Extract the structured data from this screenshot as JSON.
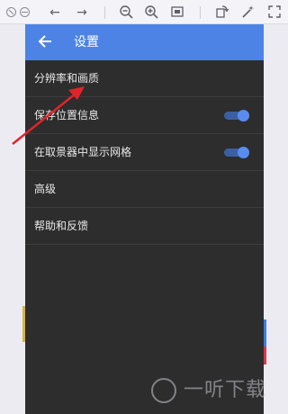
{
  "toolbar": {
    "icons": [
      "close-icon",
      "minimize-icon",
      "back-arrow-icon",
      "forward-arrow-icon",
      "zoom-out-icon",
      "zoom-in-icon",
      "fit-screen-icon",
      "rotate-icon",
      "magic-wand-icon",
      "maximize-icon"
    ]
  },
  "appbar": {
    "title": "设置"
  },
  "settings": {
    "items": [
      {
        "label": "分辨率和画质"
      },
      {
        "label": "保存位置信息",
        "toggle": true
      },
      {
        "label": "在取景器中显示网格",
        "toggle": true
      },
      {
        "label": "高级"
      },
      {
        "label": "帮助和反馈"
      }
    ]
  },
  "colors": {
    "appbar": "#4e83e6",
    "background": "#2d2d2d",
    "toggle_on": "#5a8cf0",
    "annotation_arrow": "#e0242a"
  },
  "watermark": {
    "text": "一听下载"
  }
}
